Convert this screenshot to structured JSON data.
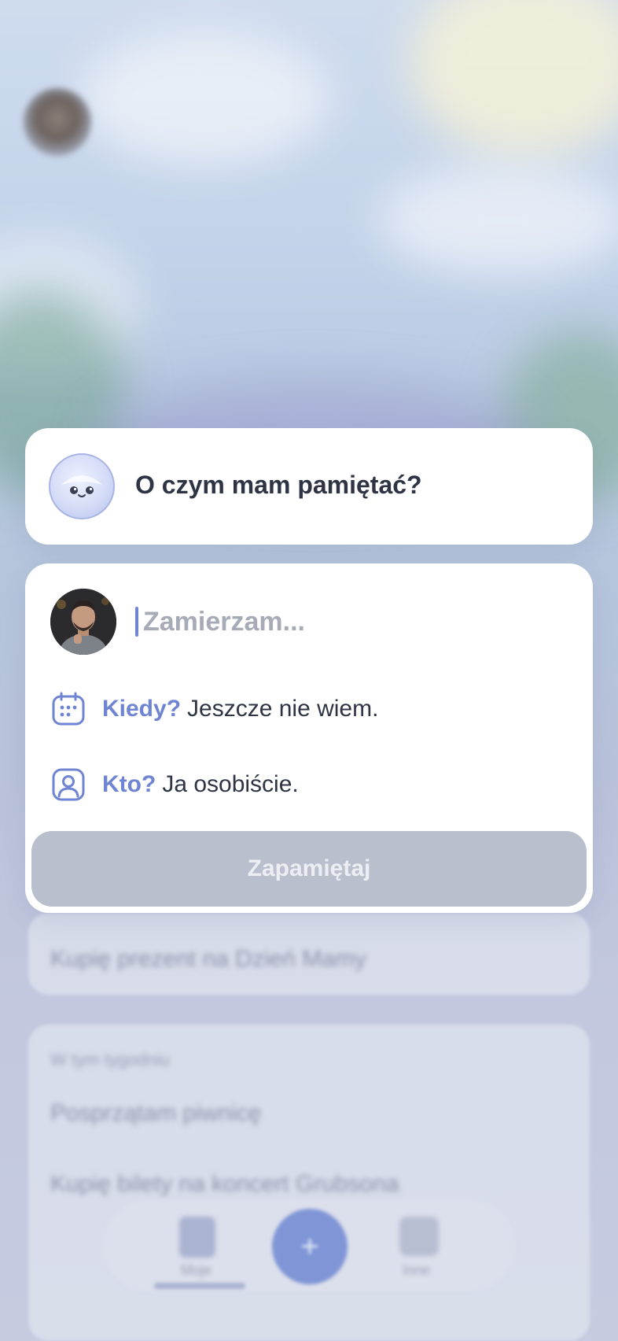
{
  "prompt_card": {
    "question": "O czym mam pamiętać?",
    "mascot_icon": "ghost-mascot-icon"
  },
  "form": {
    "task_input": {
      "value": "",
      "placeholder": "Zamierzam..."
    },
    "when": {
      "label": "Kiedy?",
      "value": "Jeszcze nie wiem.",
      "icon": "calendar-icon"
    },
    "who": {
      "label": "Kto?",
      "value": "Ja osobiście.",
      "icon": "user-square-icon"
    },
    "save_label": "Zapamiętaj"
  },
  "colors": {
    "accent": "#6f84d2",
    "text_dark": "#2f3445",
    "placeholder": "#a7abb8",
    "button_disabled_bg": "#babfce",
    "button_disabled_text": "#eceef4"
  }
}
